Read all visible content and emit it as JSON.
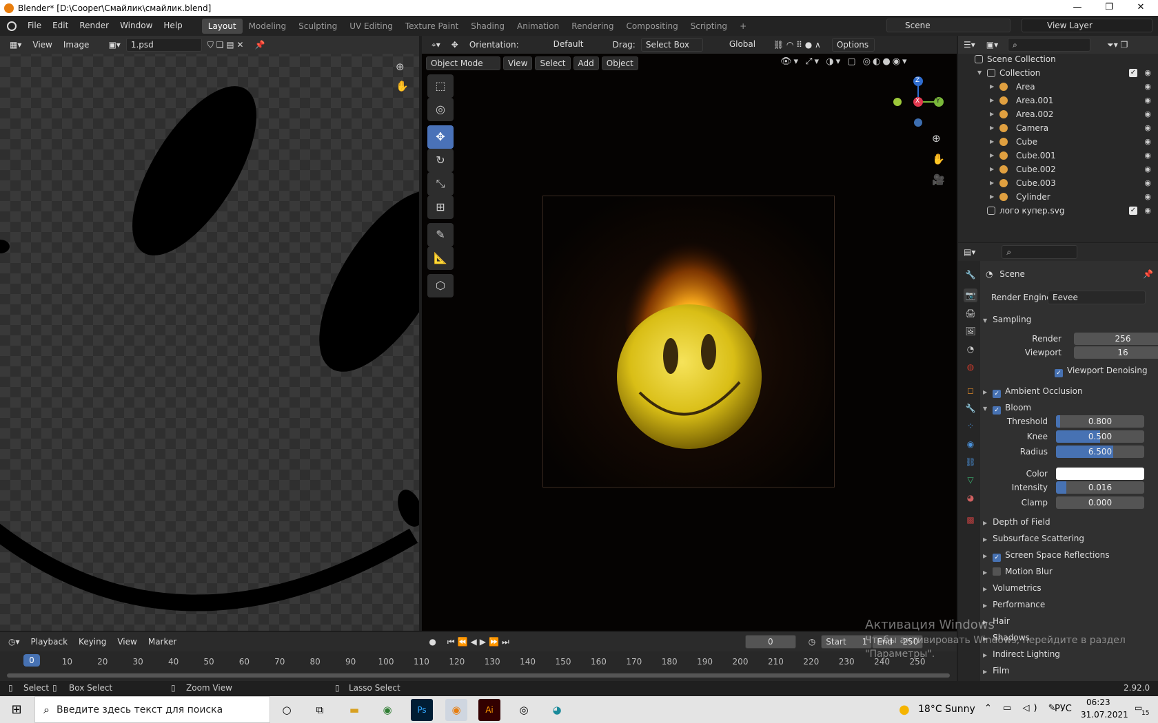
{
  "window": {
    "title": "Blender* [D:\\Cooper\\Смайлик\\смайлик.blend]",
    "minimize": "—",
    "maximize": "❐",
    "close": "✕"
  },
  "menu": [
    "File",
    "Edit",
    "Render",
    "Window",
    "Help"
  ],
  "workspaces": [
    "Layout",
    "Modeling",
    "Sculpting",
    "UV Editing",
    "Texture Paint",
    "Shading",
    "Animation",
    "Rendering",
    "Compositing",
    "Scripting"
  ],
  "scene_name": "Scene",
  "view_layer": "View Layer",
  "image_editor": {
    "view": "View",
    "image": "Image",
    "image_name": "1.psd"
  },
  "viewport": {
    "orientation_label": "Orientation:",
    "orientation": "Default",
    "drag_label": "Drag:",
    "drag": "Select Box",
    "transform": "Global",
    "options": "Options",
    "mode": "Object Mode",
    "view": "View",
    "select": "Select",
    "add": "Add",
    "object": "Object",
    "axis_z": "Z",
    "axis_x": "X",
    "axis_y": "Y"
  },
  "outliner": {
    "root": "Scene Collection",
    "collection": "Collection",
    "items": [
      {
        "name": "Area",
        "color": "#e0a040"
      },
      {
        "name": "Area.001",
        "color": "#e0a040"
      },
      {
        "name": "Area.002",
        "color": "#e0a040"
      },
      {
        "name": "Camera",
        "color": "#e0a040"
      },
      {
        "name": "Cube",
        "color": "#e0a040"
      },
      {
        "name": "Cube.001",
        "color": "#e0a040"
      },
      {
        "name": "Cube.002",
        "color": "#e0a040"
      },
      {
        "name": "Cube.003",
        "color": "#e0a040"
      },
      {
        "name": "Cylinder",
        "color": "#e0a040"
      }
    ],
    "extra": "лого купер.svg"
  },
  "properties": {
    "context": "Scene",
    "render_engine_label": "Render Engine",
    "render_engine": "Eevee",
    "sampling": "Sampling",
    "render_label": "Render",
    "render_value": "256",
    "viewport_label": "Viewport",
    "viewport_value": "16",
    "denoise": "Viewport Denoising",
    "ambient_occlusion": "Ambient Occlusion",
    "bloom": "Bloom",
    "bloom_fields": [
      {
        "label": "Threshold",
        "value": "0.800",
        "fill": 0.05
      },
      {
        "label": "Knee",
        "value": "0.500",
        "fill": 0.5
      },
      {
        "label": "Radius",
        "value": "6.500",
        "fill": 0.65
      },
      {
        "label": "Intensity",
        "value": "0.016",
        "fill": 0.12
      },
      {
        "label": "Clamp",
        "value": "0.000",
        "fill": 0
      }
    ],
    "color_label": "Color",
    "panels": [
      {
        "label": "Depth of Field",
        "check": null
      },
      {
        "label": "Subsurface Scattering",
        "check": null
      },
      {
        "label": "Screen Space Reflections",
        "check": true
      },
      {
        "label": "Motion Blur",
        "check": false
      },
      {
        "label": "Volumetrics",
        "check": null
      },
      {
        "label": "Performance",
        "check": null
      },
      {
        "label": "Hair",
        "check": null
      },
      {
        "label": "Shadows",
        "check": null
      },
      {
        "label": "Indirect Lighting",
        "check": null
      },
      {
        "label": "Film",
        "check": null
      }
    ]
  },
  "timeline": {
    "playback": "Playback",
    "keying": "Keying",
    "view": "View",
    "marker": "Marker",
    "current_frame": "0",
    "start_label": "Start",
    "start": "1",
    "end_label": "End",
    "end": "250",
    "ticks": [
      "0",
      "10",
      "20",
      "30",
      "40",
      "50",
      "60",
      "70",
      "80",
      "90",
      "100",
      "110",
      "120",
      "130",
      "140",
      "150",
      "160",
      "170",
      "180",
      "190",
      "200",
      "210",
      "220",
      "230",
      "240",
      "250"
    ]
  },
  "activation": {
    "line1": "Активация Windows",
    "line2": "Чтобы активировать Windows, перейдите в раздел",
    "line3": "\"Параметры\"."
  },
  "status": {
    "select": "Select",
    "box_select": "Box Select",
    "zoom_view": "Zoom View",
    "lasso_select": "Lasso Select",
    "version": "2.92.0"
  },
  "taskbar": {
    "search": "Введите здесь текст для поиска",
    "weather": "18°C  Sunny",
    "lang": "РУС",
    "time": "06:23",
    "date": "31.07.2021",
    "notif": "15"
  }
}
